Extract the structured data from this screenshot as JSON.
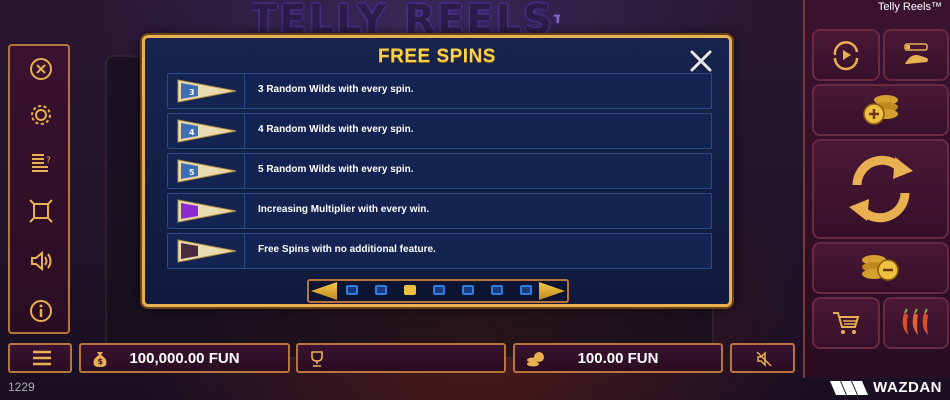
{
  "game": {
    "title": "Telly Reels™",
    "logo_text": "TELLY REELS",
    "logo_tm": "TM"
  },
  "dialog": {
    "title": "FREE SPINS",
    "rows": [
      {
        "text": "3 Random Wilds with every spin.",
        "badge_color": "#3d6fb8",
        "badge_label": "3"
      },
      {
        "text": "4 Random Wilds with every spin.",
        "badge_color": "#3d6fb8",
        "badge_label": "4"
      },
      {
        "text": "5 Random Wilds with every spin.",
        "badge_color": "#3d6fb8",
        "badge_label": "5"
      },
      {
        "text": "Increasing Multiplier with every win.",
        "badge_color": "#8a2ad0",
        "badge_label": ""
      },
      {
        "text": "Free Spins with no additional feature.",
        "badge_color": "#4a2a40",
        "badge_label": ""
      }
    ],
    "pager": {
      "pages": 7,
      "current": 3
    }
  },
  "left_menu": [
    {
      "icon": "close-icon"
    },
    {
      "icon": "gear-icon"
    },
    {
      "icon": "paytable-icon"
    },
    {
      "icon": "fullscreen-icon"
    },
    {
      "icon": "sound-icon"
    },
    {
      "icon": "info-icon"
    }
  ],
  "bottom_bar": {
    "balance": "100,000.00 FUN",
    "win": "",
    "bet": "100.00 FUN"
  },
  "footer": {
    "time": "1229",
    "brand": "WAZDAN"
  },
  "colors": {
    "accent_gold": "#e8b050",
    "title_yellow": "#ffd24a",
    "panel_maroon": "#3a1230",
    "dialog_navy": "#17244e"
  }
}
